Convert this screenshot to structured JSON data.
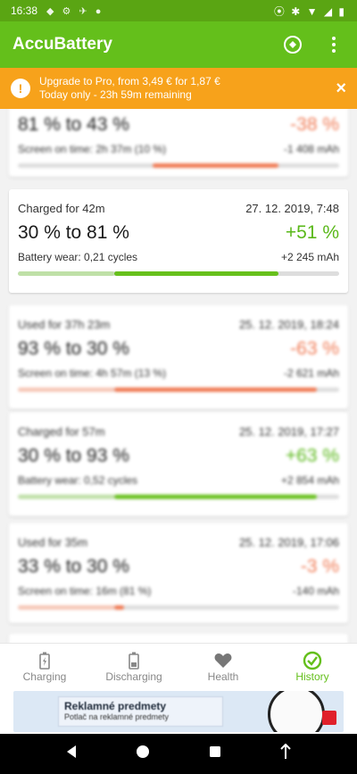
{
  "status_bar": {
    "time": "16:38",
    "battery": "41"
  },
  "app": {
    "title": "AccuBattery"
  },
  "promo": {
    "badge": "!",
    "line1": "Upgrade to Pro, from 3,49 € for 1,87 €",
    "line2": "Today only - 23h 59m remaining",
    "close": "×"
  },
  "sessions": [
    {
      "header": "",
      "date": "",
      "range": "81 % to 43 %",
      "change": "-38 %",
      "sub_label": "Screen on time: 2h 37m (10 %)",
      "sub_value": "-1 408 mAh",
      "bar": {
        "start": 0.42,
        "end": 0.81,
        "color": "#f07b55"
      },
      "change_color": "#f07b55"
    },
    {
      "header": "Charged for 42m",
      "date": "27. 12. 2019, 7:48",
      "range": "30 % to 81 %",
      "change": "+51 %",
      "sub_label": "Battery wear: 0,21 cycles",
      "sub_value": "+2 245 mAh",
      "bar": {
        "start": 0.3,
        "end": 0.81,
        "color": "#67c01c",
        "faded_start": 0.0,
        "faded_color": "#bfe0a7"
      },
      "change_color": "#5ab81a"
    },
    {
      "header": "Used for 37h 23m",
      "date": "25. 12. 2019, 18:24",
      "range": "93 % to 30 %",
      "change": "-63 %",
      "sub_label": "Screen on time: 4h 57m (13 %)",
      "sub_value": "-2 621 mAh",
      "bar": {
        "start": 0.3,
        "end": 0.93,
        "color": "#f07b55",
        "faded_start": 0.0,
        "faded_color": "#f6c7b7"
      },
      "change_color": "#f07b55"
    },
    {
      "header": "Charged for 57m",
      "date": "25. 12. 2019, 17:27",
      "range": "30 % to 93 %",
      "change": "+63 %",
      "sub_label": "Battery wear: 0,52 cycles",
      "sub_value": "+2 854 mAh",
      "bar": {
        "start": 0.3,
        "end": 0.93,
        "color": "#67c01c",
        "faded_start": 0.0,
        "faded_color": "#bfe0a7"
      },
      "change_color": "#5ab81a"
    },
    {
      "header": "Used for 35m",
      "date": "25. 12. 2019, 17:06",
      "range": "33 % to 30 %",
      "change": "-3 %",
      "sub_label": "Screen on time: 16m (81 %)",
      "sub_value": "-140 mAh",
      "bar": {
        "start": 0.3,
        "end": 0.33,
        "color": "#f07b55",
        "faded_start": 0.0,
        "faded_color": "#f6c7b7"
      },
      "change_color": "#f07b55"
    }
  ],
  "bottom_nav": [
    {
      "label": "Charging",
      "icon": "battery-charging-icon"
    },
    {
      "label": "Discharging",
      "icon": "battery-discharging-icon"
    },
    {
      "label": "Health",
      "icon": "heart-icon"
    },
    {
      "label": "History",
      "icon": "history-icon",
      "active": true
    }
  ],
  "ad": {
    "title": "Reklamné predmety",
    "subtitle": "Potlač na reklamné predmety"
  },
  "colors": {
    "primary": "#64bf1b",
    "status": "#5aa513",
    "promo": "#f7a21b",
    "discharge": "#f07b55",
    "charge": "#67c01c"
  }
}
